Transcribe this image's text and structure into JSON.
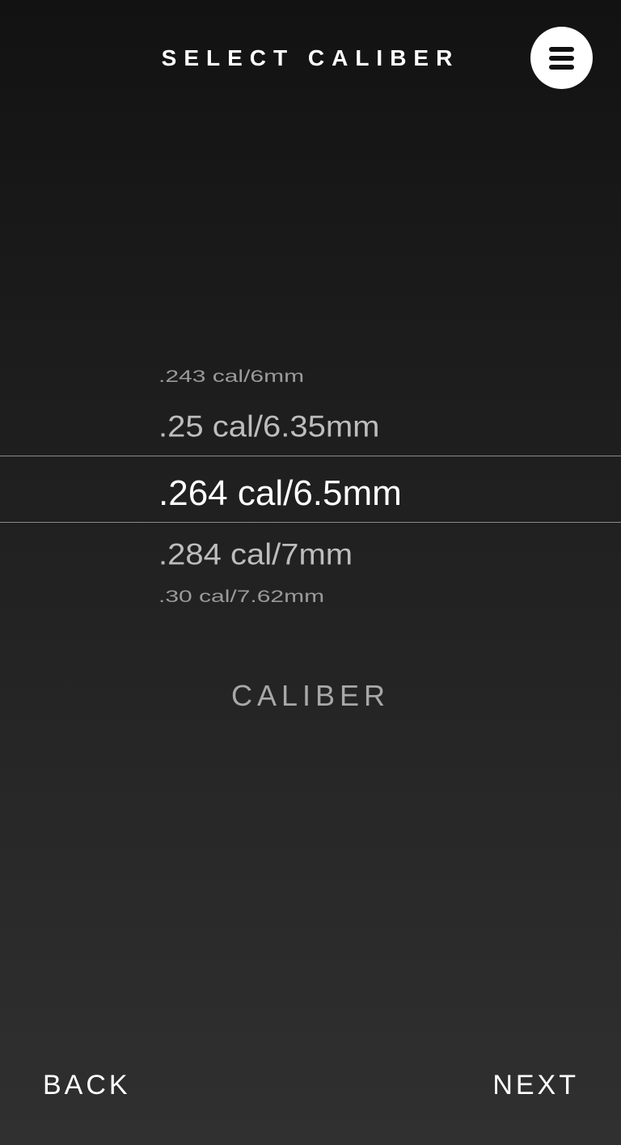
{
  "header": {
    "title": "SELECT CALIBER",
    "menu_icon": "hamburger-menu-icon"
  },
  "picker": {
    "items": [
      ".243 cal/6mm",
      ".25 cal/6.35mm",
      ".264 cal/6.5mm",
      ".284 cal/7mm",
      ".30 cal/7.62mm"
    ],
    "selected": ".264 cal/6.5mm",
    "label": "CALIBER"
  },
  "nav": {
    "back_label": "BACK",
    "next_label": "NEXT"
  }
}
